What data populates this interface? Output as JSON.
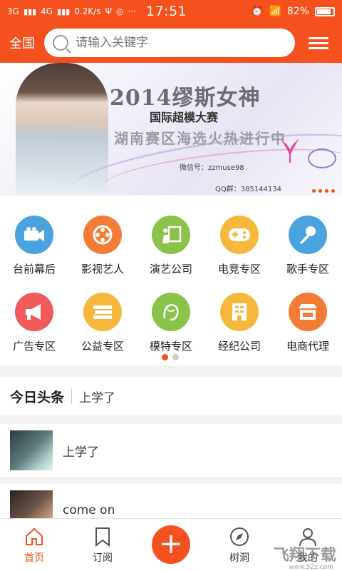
{
  "status_bar": {
    "network1": "3G",
    "network2": "4G",
    "speed": "0.2K/s",
    "extra": "···",
    "time": "17:51",
    "battery": "82%"
  },
  "header": {
    "region": "全国",
    "search_placeholder": "请输入关键字"
  },
  "banner": {
    "title": "2014缪斯女神",
    "subtitle": "国际超模大赛",
    "subtitle2": "湖南赛区海选火热进行中",
    "wechat": "微信号：zzmuse98",
    "qq": "QQ群：385144134"
  },
  "categories": {
    "row1": [
      {
        "label": "台前幕后",
        "icon": "camera-icon",
        "color": "#4aa3df"
      },
      {
        "label": "影视艺人",
        "icon": "film-reel-icon",
        "color": "#f27b35"
      },
      {
        "label": "演艺公司",
        "icon": "piano-icon",
        "color": "#8bc34a"
      },
      {
        "label": "电竞专区",
        "icon": "gamepad-icon",
        "color": "#f6b83c"
      },
      {
        "label": "歌手专区",
        "icon": "microphone-icon",
        "color": "#4aa3df"
      }
    ],
    "row2": [
      {
        "label": "广告专区",
        "icon": "megaphone-icon",
        "color": "#ef5a5a"
      },
      {
        "label": "公益专区",
        "icon": "books-icon",
        "color": "#f6b83c"
      },
      {
        "label": "模特专区",
        "icon": "model-face-icon",
        "color": "#8bc34a"
      },
      {
        "label": "经纪公司",
        "icon": "building-icon",
        "color": "#f6b83c"
      },
      {
        "label": "电商代理",
        "icon": "shop-icon",
        "color": "#f27b35"
      }
    ]
  },
  "headlines": {
    "title": "今日头条",
    "ticker": "上学了"
  },
  "feed": [
    {
      "text": "上学了"
    },
    {
      "text": "come  on"
    }
  ],
  "bottom_nav": {
    "home": "首页",
    "subscribe": "订阅",
    "add": "+",
    "treehole": "树洞",
    "mine": "我的"
  },
  "watermark": {
    "main": "飞翔下载",
    "sub": "www.52z.com"
  },
  "colors": {
    "accent": "#f4511e"
  }
}
